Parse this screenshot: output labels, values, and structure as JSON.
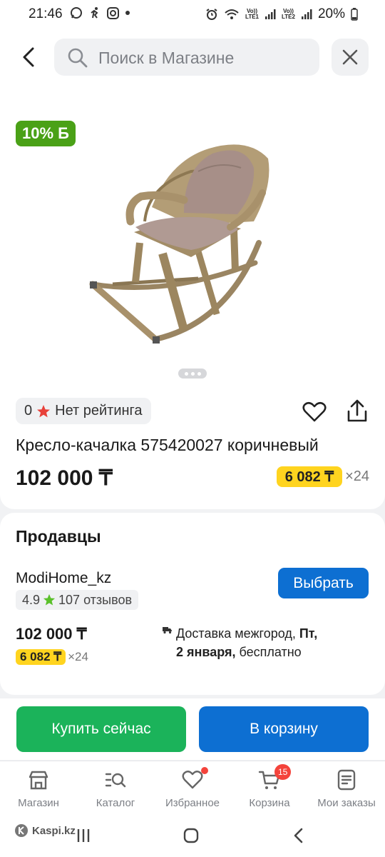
{
  "status_bar": {
    "time": "21:46",
    "sim1_label_top": "Vo))",
    "sim1_label_bottom": "LTE1",
    "sim2_label_top": "Vo))",
    "sim2_label_bottom": "LTE2",
    "battery": "20%"
  },
  "search": {
    "placeholder": "Поиск в Магазине"
  },
  "product": {
    "discount_badge": "10% Б",
    "rating_count": "0",
    "rating_text": "Нет рейтинга",
    "title": "Кресло-качалка 575420027 коричневый",
    "price": "102 000 ₸",
    "installment": "6 082 ₸",
    "installment_months": "×24",
    "image_count": 3,
    "active_image": 1
  },
  "sellers": {
    "heading": "Продавцы",
    "items": [
      {
        "name": "ModiHome_kz",
        "rating": "4.9",
        "reviews": "107 отзывов",
        "choose_label": "Выбрать",
        "price": "102 000 ₸",
        "installment": "6 082 ₸",
        "installment_months": "×24",
        "delivery_prefix": "Доставка межгород, ",
        "delivery_day": "Пт,",
        "delivery_date": "2 января,",
        "delivery_suffix": " бесплатно"
      }
    ]
  },
  "actions": {
    "buy_now": "Купить сейчас",
    "add_to_cart": "В корзину"
  },
  "tabbar": {
    "items": [
      {
        "label": "Магазин",
        "icon": "shop-icon"
      },
      {
        "label": "Каталог",
        "icon": "catalog-icon"
      },
      {
        "label": "Избранное",
        "icon": "heart-icon"
      },
      {
        "label": "Корзина",
        "icon": "cart-icon",
        "badge": "15"
      },
      {
        "label": "Мои заказы",
        "icon": "orders-icon"
      }
    ]
  },
  "watermark": "Kaspi.kz",
  "colors": {
    "accent_blue": "#0d6fd2",
    "buy_green": "#1bb35a",
    "badge_green": "#4aa117",
    "installment_yellow": "#ffd41f",
    "notification_red": "#f4433b"
  }
}
